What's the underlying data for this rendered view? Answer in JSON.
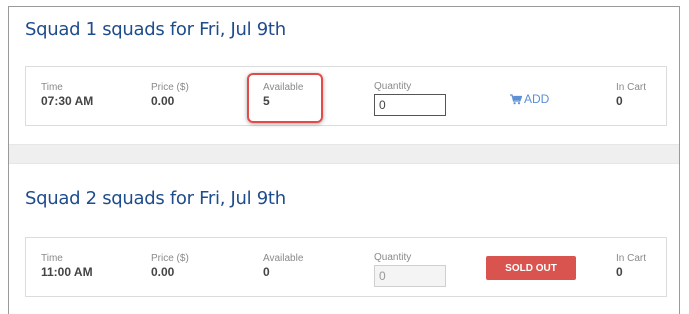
{
  "squads": [
    {
      "title": "Squad 1 squads for Fri, Jul 9th",
      "time_label": "Time",
      "time": "07:30 AM",
      "price_label": "Price ($)",
      "price": "0.00",
      "available_label": "Available",
      "available": "5",
      "quantity_label": "Quantity",
      "quantity_value": "0",
      "action_label": "ADD",
      "action_icon": "cart-icon",
      "in_cart_label": "In Cart",
      "in_cart": "0"
    },
    {
      "title": "Squad 2 squads for Fri, Jul 9th",
      "time_label": "Time",
      "time": "11:00 AM",
      "price_label": "Price ($)",
      "price": "0.00",
      "available_label": "Available",
      "available": "0",
      "quantity_label": "Quantity",
      "quantity_value": "0",
      "action_label": "SOLD OUT",
      "in_cart_label": "In Cart",
      "in_cart": "0"
    }
  ],
  "colors": {
    "title": "#1e4c8c",
    "add_link": "#5b8fd6",
    "sold_out": "#d9534f",
    "highlight": "#e34b4b"
  }
}
